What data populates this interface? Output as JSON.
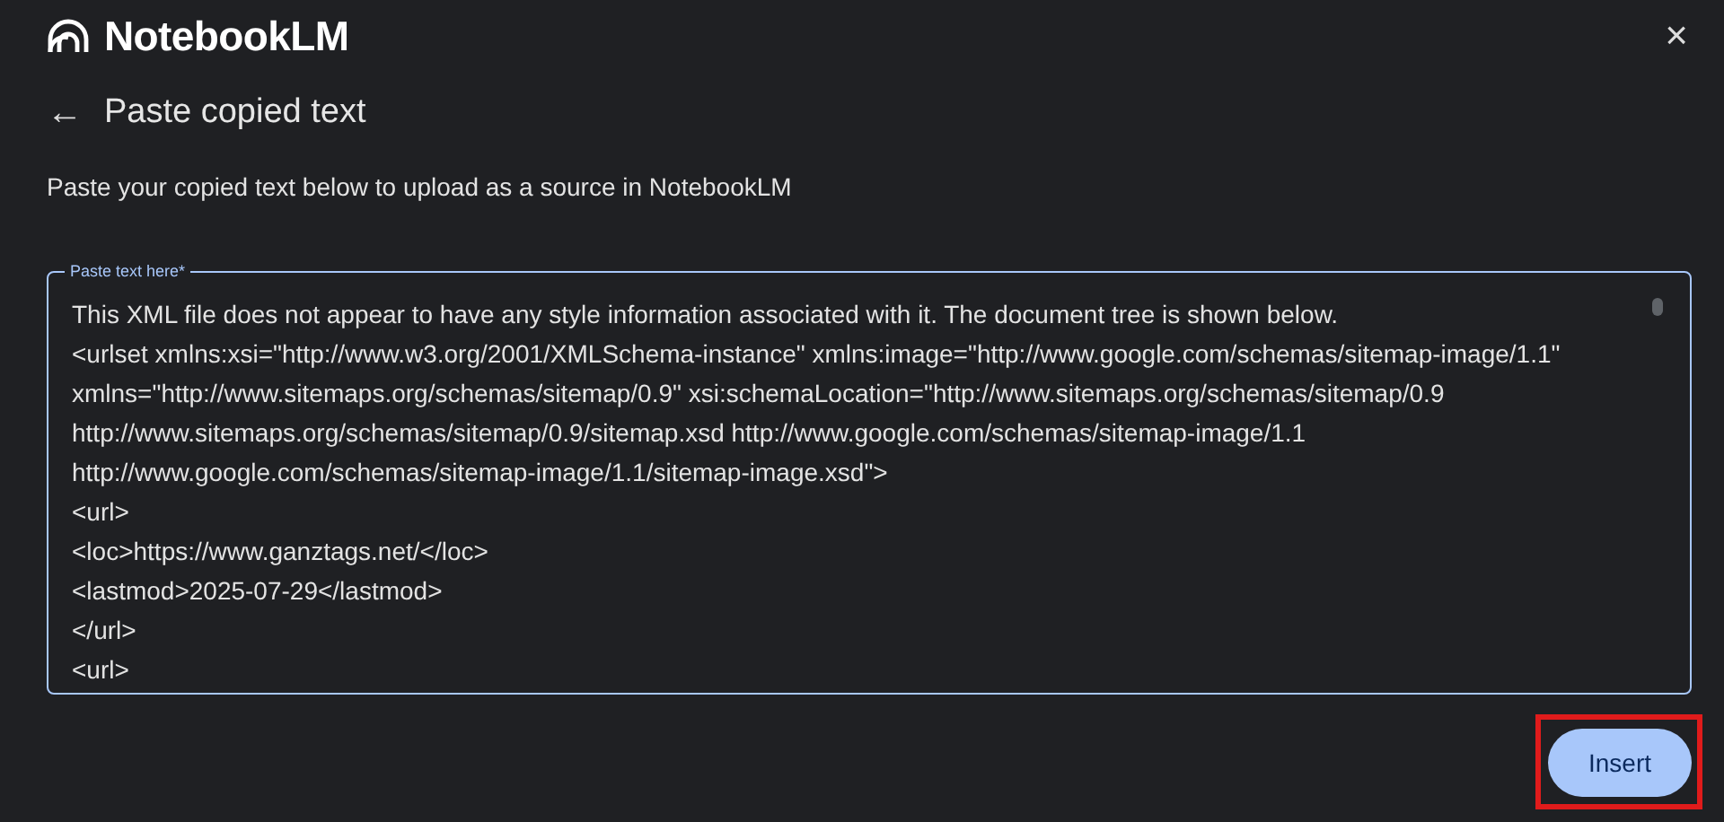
{
  "header": {
    "title": "NotebookLM",
    "close": "×"
  },
  "page": {
    "back": "←",
    "title": "Paste copied text",
    "description": "Paste your copied text below to upload as a source in NotebookLM"
  },
  "text_field": {
    "label": "Paste text here*",
    "focused": true,
    "value_lines": [
      "This XML file does not appear to have any style information associated with it. The document tree is shown below.",
      "<urlset xmlns:xsi=\"http://www.w3.org/2001/XMLSchema-instance\" xmlns:image=\"http://www.google.com/schemas/sitemap-image/1.1\"",
      "xmlns=\"http://www.sitemaps.org/schemas/sitemap/0.9\" xsi:schemaLocation=\"http://www.sitemaps.org/schemas/sitemap/0.9",
      "http://www.sitemaps.org/schemas/sitemap/0.9/sitemap.xsd http://www.google.com/schemas/sitemap-image/1.1",
      "http://www.google.com/schemas/sitemap-image/1.1/sitemap-image.xsd\">",
      "<url>",
      "<loc>https://www.ganztags.net/</loc>",
      "<lastmod>2025-07-29</lastmod>",
      "</url>",
      "<url>"
    ]
  },
  "insert_button": {
    "label": "Insert",
    "highlighted": true
  }
}
